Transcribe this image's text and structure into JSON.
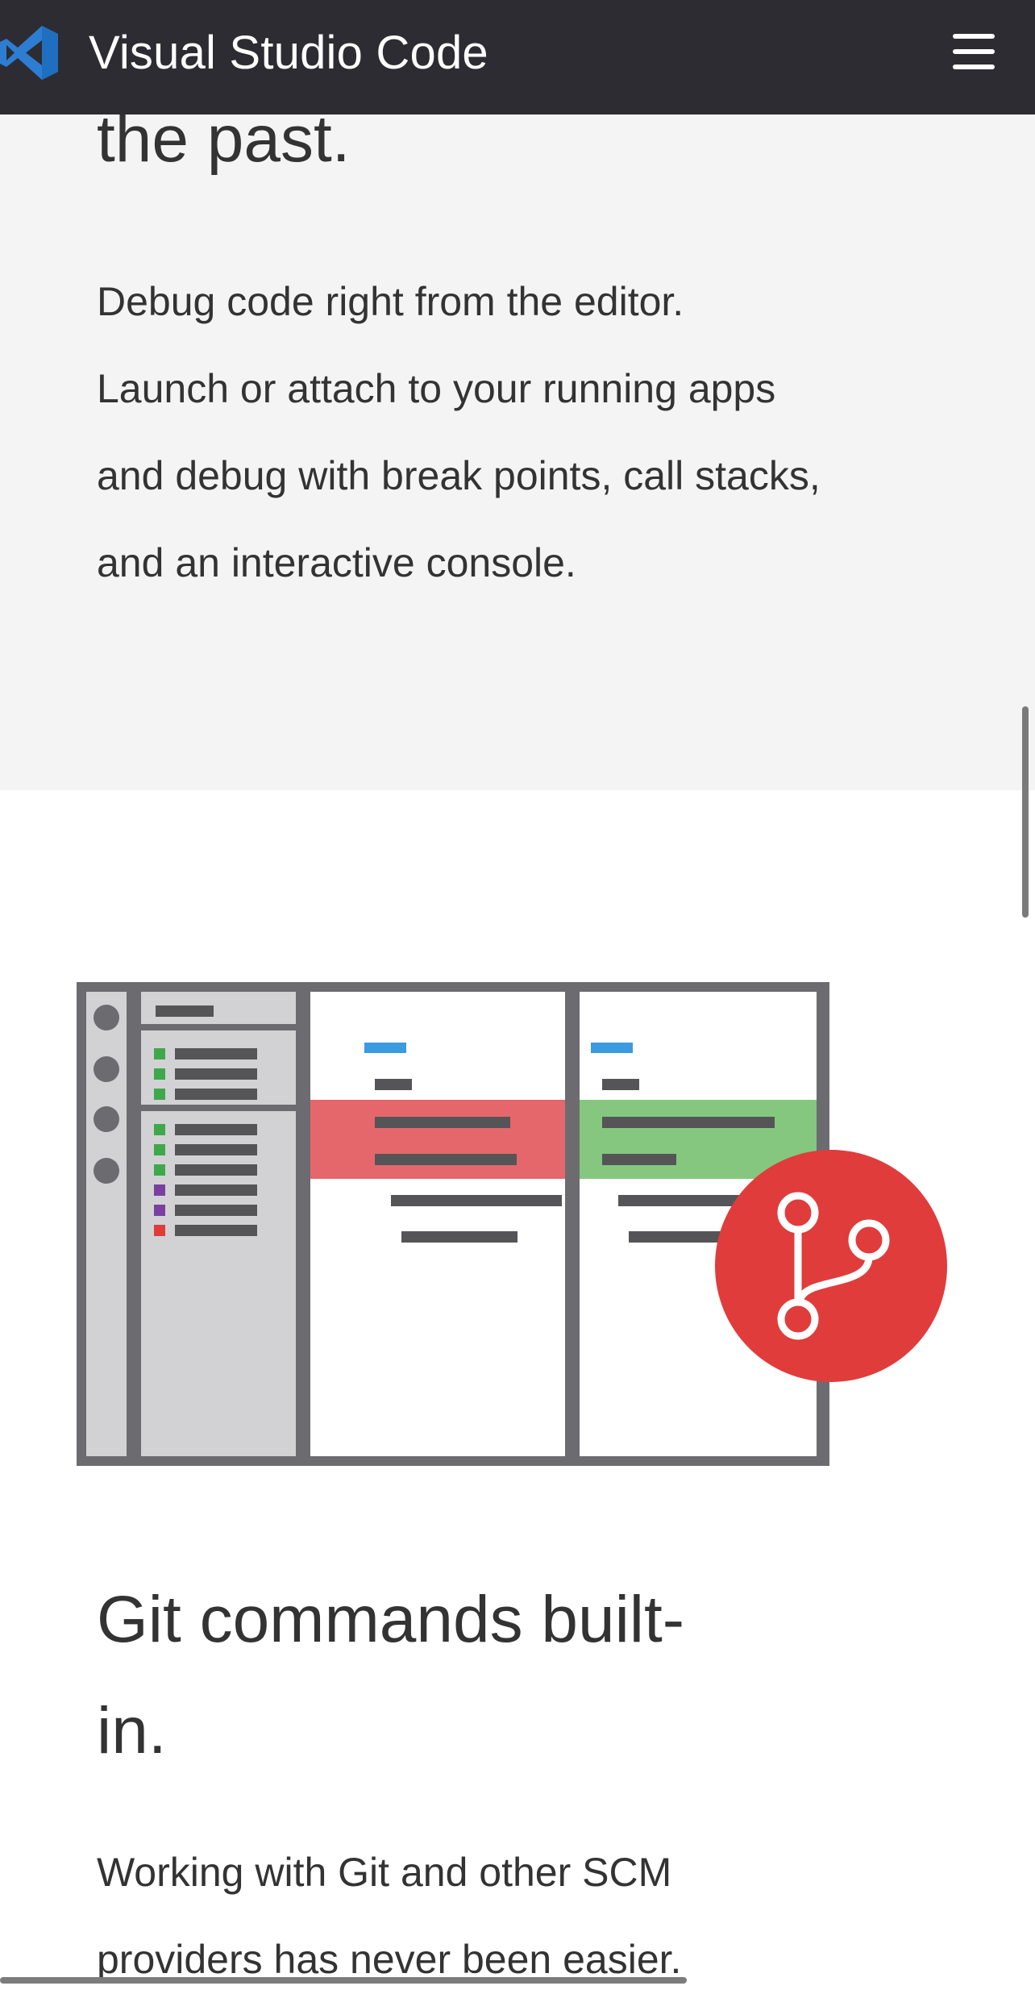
{
  "navbar": {
    "brand_name": "Visual Studio Code",
    "logo_icon": "vscode-logo-icon",
    "menu_icon": "hamburger-menu-icon",
    "bg_color": "#2c2c32"
  },
  "debug_section": {
    "heading_fragment": "the past.",
    "paragraph_lines": [
      "Debug code right from the editor.",
      "Launch or attach to your running apps",
      "and debug with break points, call stacks,",
      "and an interactive console."
    ],
    "bg_color": "#f4f4f4"
  },
  "git_section": {
    "illustration_icon": "git-branch-icon",
    "heading_lines": [
      "Git commands built-",
      "in."
    ],
    "paragraph_lines": [
      "Working with Git and other SCM",
      "providers has never been easier."
    ],
    "accent_color": "#e03c3c",
    "added_color": "#85c77f",
    "removed_color": "#e5676c"
  }
}
